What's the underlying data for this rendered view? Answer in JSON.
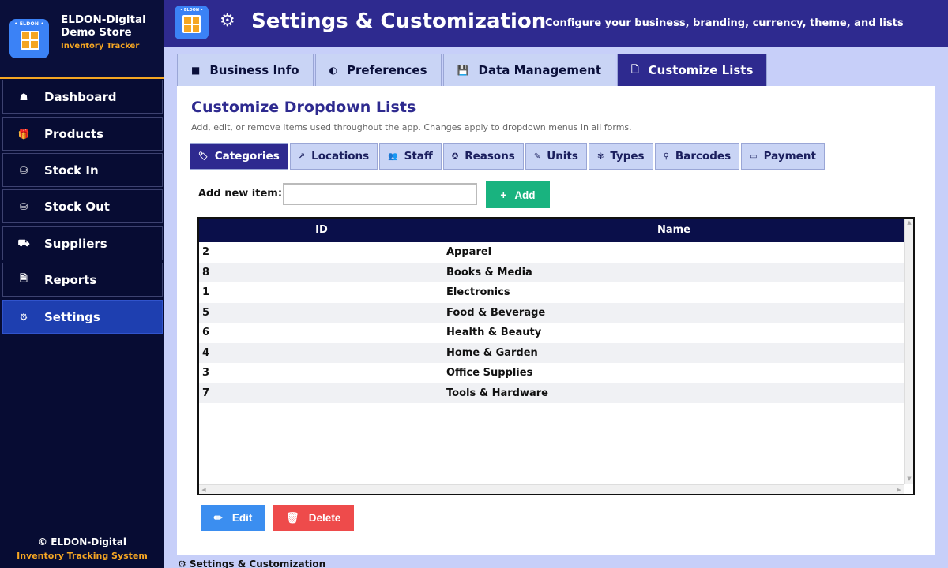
{
  "sidebar": {
    "brand_badge": "• ELDON •",
    "brand_name": "ELDON-Digital Demo Store",
    "brand_sub": "Inventory Tracker",
    "items": [
      {
        "icon": "☗",
        "label": "Dashboard"
      },
      {
        "icon": "🎁",
        "label": "Products"
      },
      {
        "icon": "⛁",
        "label": "Stock In"
      },
      {
        "icon": "⛁",
        "label": "Stock Out"
      },
      {
        "icon": "⛟",
        "label": "Suppliers"
      },
      {
        "icon": "🗎",
        "label": "Reports"
      },
      {
        "icon": "⚙",
        "label": "Settings"
      }
    ],
    "footer_copyright": "© ELDON-Digital",
    "footer_system": "Inventory Tracking System"
  },
  "header": {
    "badge": "• ELDON •",
    "title": "Settings & Customization",
    "subtitle": "Configure your business, branding, currency, theme, and lists"
  },
  "tabs": [
    {
      "icon": "■",
      "label": "Business Info"
    },
    {
      "icon": "◐",
      "label": "Preferences"
    },
    {
      "icon": "💾",
      "label": "Data Management"
    },
    {
      "icon": "🗋",
      "label": "Customize Lists"
    }
  ],
  "panel": {
    "title": "Customize Dropdown Lists",
    "description": "Add, edit, or remove items used throughout the app. Changes apply to dropdown menus in all forms."
  },
  "subtabs": [
    {
      "icon": "🏷",
      "label": "Categories"
    },
    {
      "icon": "↗",
      "label": "Locations"
    },
    {
      "icon": "👥",
      "label": "Staff"
    },
    {
      "icon": "✪",
      "label": "Reasons"
    },
    {
      "icon": "✎",
      "label": "Units"
    },
    {
      "icon": "✾",
      "label": "Types"
    },
    {
      "icon": "⚲",
      "label": "Barcodes"
    },
    {
      "icon": "▭",
      "label": "Payment"
    }
  ],
  "add": {
    "label": "Add new item:",
    "value": "",
    "button_icon": "+",
    "button_label": "Add"
  },
  "table": {
    "headers": [
      "ID",
      "Name"
    ],
    "rows": [
      [
        "2",
        "Apparel"
      ],
      [
        "8",
        "Books & Media"
      ],
      [
        "1",
        "Electronics"
      ],
      [
        "5",
        "Food & Beverage"
      ],
      [
        "6",
        "Health & Beauty"
      ],
      [
        "4",
        "Home & Garden"
      ],
      [
        "3",
        "Office Supplies"
      ],
      [
        "7",
        "Tools & Hardware"
      ]
    ]
  },
  "actions": {
    "edit_icon": "✏",
    "edit_label": "Edit",
    "delete_icon": "🗑",
    "delete_label": "Delete"
  },
  "status_bar": "⚙ Settings & Customization",
  "colors": {
    "accent": "#2e2a8f",
    "brand_orange": "#f5a623",
    "add_green": "#19b37f",
    "edit_blue": "#3b8ef0",
    "delete_red": "#ee4b4b"
  }
}
